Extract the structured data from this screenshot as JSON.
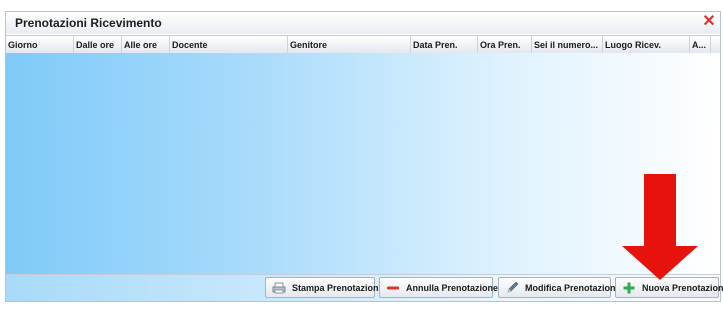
{
  "window": {
    "title": "Prenotazioni Ricevimento"
  },
  "table": {
    "columns": [
      "Giorno",
      "Dalle ore",
      "Alle ore",
      "Docente",
      "Genitore",
      "Data Pren.",
      "Ora Pren.",
      "Sei il numero...",
      "Luogo Ricev.",
      "A..."
    ]
  },
  "toolbar": {
    "stampa_label": "Stampa Prenotazioni",
    "annulla_label": "Annulla Prenotazione",
    "modifica_label": "Modifica Prenotazione",
    "nuova_label": "Nuova Prenotazione"
  },
  "colors": {
    "arrow": "#e8120c",
    "close": "#e0322b",
    "minus": "#e0322b",
    "plus": "#2fa84f"
  },
  "icons": [
    "close-icon",
    "printer-icon",
    "minus-icon",
    "pencil-icon",
    "plus-icon"
  ]
}
